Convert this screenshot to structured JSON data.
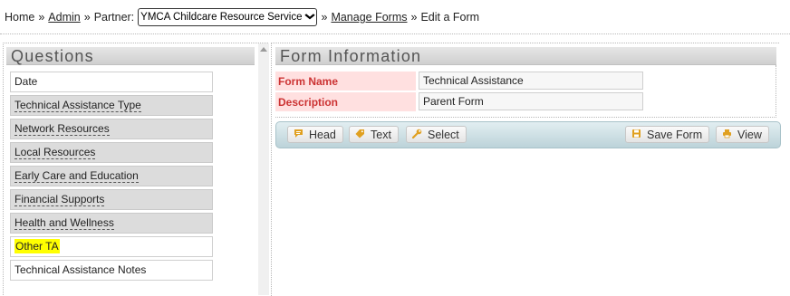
{
  "breadcrumb": {
    "home": "Home",
    "sep1": "»",
    "admin": "Admin",
    "sep2": "»",
    "partner_label": "Partner:",
    "partner_selected": "YMCA Childcare Resource Service",
    "sep3": "»",
    "manage_forms": "Manage Forms",
    "sep4": "»",
    "current": "Edit a Form"
  },
  "questions": {
    "title": "Questions",
    "items": [
      {
        "label": "Date"
      },
      {
        "label": "Technical Assistance Type"
      },
      {
        "label": "Network Resources"
      },
      {
        "label": "Local Resources"
      },
      {
        "label": "Early Care and Education"
      },
      {
        "label": "Financial Supports"
      },
      {
        "label": "Health and Wellness"
      },
      {
        "label": "Other TA"
      },
      {
        "label": "Technical Assistance Notes"
      }
    ]
  },
  "form_info": {
    "title": "Form Information",
    "name_label": "Form Name",
    "name_value": "Technical Assistance",
    "description_label": "Description",
    "description_value": "Parent Form"
  },
  "toolbar": {
    "head": "Head",
    "text": "Text",
    "select": "Select",
    "save_form": "Save Form",
    "view": "View"
  },
  "icons": {
    "head": "speech-bubble-icon",
    "text": "tag-icon",
    "select": "wrench-icon",
    "save_form": "floppy-disk-icon",
    "view": "printer-icon"
  },
  "colors": {
    "icon_accent": "#e0a020",
    "highlight": "#ffff00",
    "label_red": "#cc3333",
    "label_bg": "#ffe0e0",
    "toolbar_bg": "#c9dde2"
  }
}
